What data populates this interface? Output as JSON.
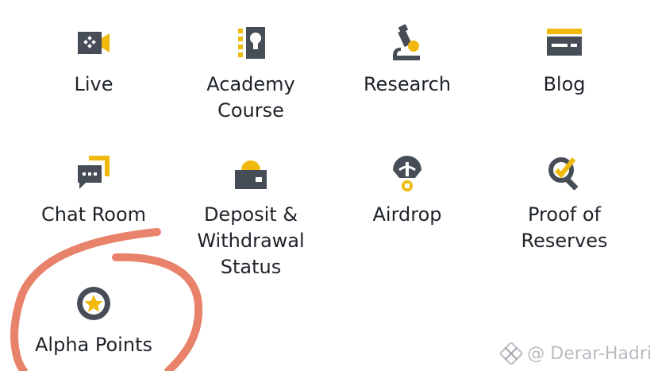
{
  "colors": {
    "accent": "#f0b90b",
    "icon_dark": "#474d57",
    "text": "#1e2329",
    "annotation": "#e8826a"
  },
  "tiles": [
    {
      "label": "Live",
      "icon": "live-camera-icon"
    },
    {
      "label": "Academy\nCourse",
      "icon": "academy-book-icon"
    },
    {
      "label": "Research",
      "icon": "research-microscope-icon"
    },
    {
      "label": "Blog",
      "icon": "blog-card-icon"
    },
    {
      "label": "Chat Room",
      "icon": "chat-bubble-icon"
    },
    {
      "label": "Deposit &\nWithdrawal\nStatus",
      "icon": "deposit-withdrawal-icon"
    },
    {
      "label": "Airdrop",
      "icon": "airdrop-parachute-icon"
    },
    {
      "label": "Proof of\nReserves",
      "icon": "proof-magnifier-icon"
    },
    {
      "label": "Alpha Points",
      "icon": "alpha-star-icon"
    }
  ],
  "watermark": {
    "text": "@ Derar-Hadri",
    "icon": "binance-diamond-icon"
  }
}
